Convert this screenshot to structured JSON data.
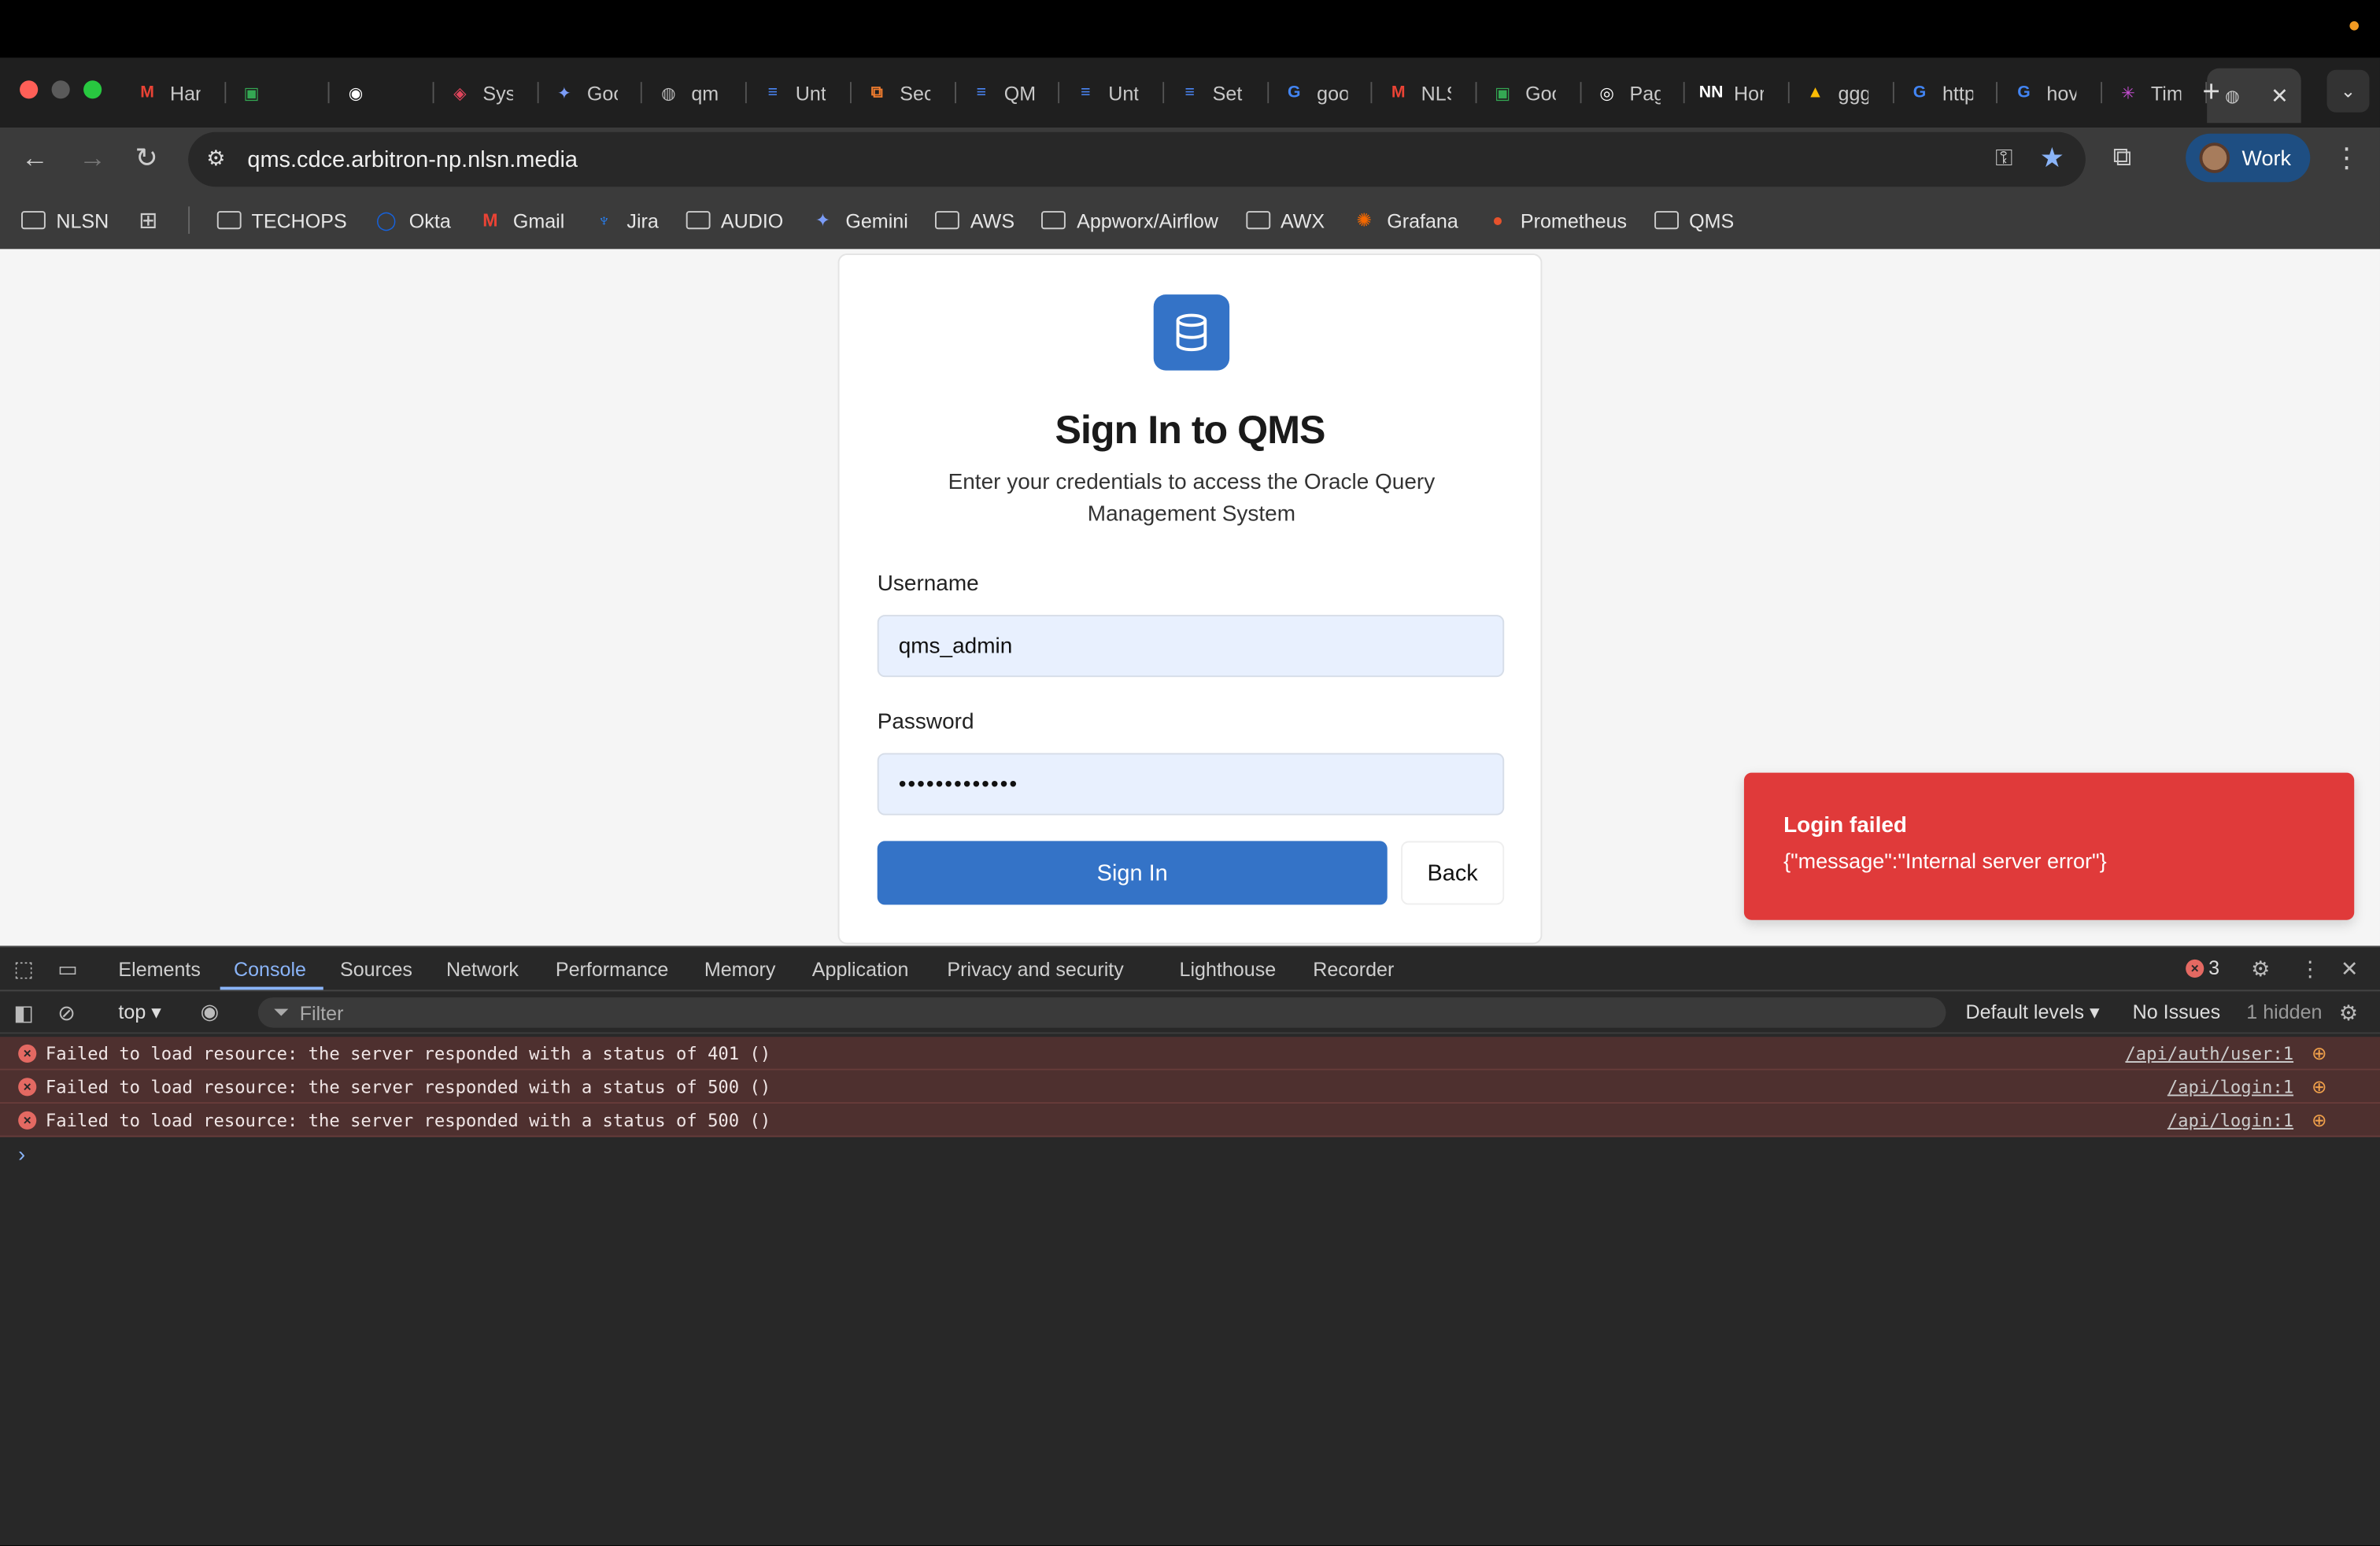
{
  "browser": {
    "tabs": [
      {
        "title": "Har",
        "icon": "gmail-icon",
        "color": "#ea4335",
        "glyph": "M"
      },
      {
        "title": "",
        "icon": "meet-icon",
        "color": "#34a853",
        "glyph": "▣"
      },
      {
        "title": "",
        "icon": "record-icon",
        "color": "#ffffff",
        "glyph": "◉"
      },
      {
        "title": "Sys",
        "icon": "sysdig-icon",
        "color": "#e0455c",
        "glyph": "◈"
      },
      {
        "title": "Goo",
        "icon": "gemini-icon",
        "color": "#7b9cf7",
        "glyph": "✦"
      },
      {
        "title": "qm",
        "icon": "globe-icon",
        "color": "#bbbbbb",
        "glyph": "◍"
      },
      {
        "title": "Unt",
        "icon": "docs-icon",
        "color": "#4a86f5",
        "glyph": "≡"
      },
      {
        "title": "Sec",
        "icon": "sec-icon",
        "color": "#f07c2e",
        "glyph": "⧉"
      },
      {
        "title": "QM",
        "icon": "docs-icon",
        "color": "#4a86f5",
        "glyph": "≡"
      },
      {
        "title": "Unt",
        "icon": "docs-icon",
        "color": "#4a86f5",
        "glyph": "≡"
      },
      {
        "title": "Set",
        "icon": "docs-icon",
        "color": "#4a86f5",
        "glyph": "≡"
      },
      {
        "title": "goo",
        "icon": "google-icon",
        "color": "#4285f4",
        "glyph": "G"
      },
      {
        "title": "NLS",
        "icon": "gmail-icon",
        "color": "#ea4335",
        "glyph": "M"
      },
      {
        "title": "Goo",
        "icon": "meet-icon",
        "color": "#34a853",
        "glyph": "▣"
      },
      {
        "title": "Pag",
        "icon": "github-icon",
        "color": "#ffffff",
        "glyph": "◎"
      },
      {
        "title": "Hor",
        "icon": "nn-icon",
        "color": "#ffffff",
        "glyph": "NN"
      },
      {
        "title": "ggg",
        "icon": "drive-icon",
        "color": "#fbbc04",
        "glyph": "▲"
      },
      {
        "title": "http",
        "icon": "google-icon",
        "color": "#4285f4",
        "glyph": "G"
      },
      {
        "title": "hov",
        "icon": "google-icon",
        "color": "#4285f4",
        "glyph": "G"
      },
      {
        "title": "Tim",
        "icon": "app-icon",
        "color": "#c94fd6",
        "glyph": "✳"
      }
    ],
    "url": "qms.cdce.arbitron-np.nlsn.media",
    "profile": "Work",
    "bookmarks": [
      {
        "label": "NLSN",
        "icon": "folder-link-icon"
      },
      {
        "label": "",
        "icon": "apps-grid-icon"
      },
      {
        "label": "TECHOPS",
        "icon": "folder-icon"
      },
      {
        "label": "Okta",
        "icon": "okta-icon"
      },
      {
        "label": "Gmail",
        "icon": "gmail-icon"
      },
      {
        "label": "Jira",
        "icon": "jira-icon"
      },
      {
        "label": "AUDIO",
        "icon": "folder-icon"
      },
      {
        "label": "Gemini",
        "icon": "gemini-icon"
      },
      {
        "label": "AWS",
        "icon": "folder-icon"
      },
      {
        "label": "Appworx/Airflow",
        "icon": "folder-icon"
      },
      {
        "label": "AWX",
        "icon": "folder-icon"
      },
      {
        "label": "Grafana",
        "icon": "grafana-icon"
      },
      {
        "label": "Prometheus",
        "icon": "prometheus-icon"
      },
      {
        "label": "QMS",
        "icon": "folder-icon"
      }
    ]
  },
  "login": {
    "title": "Sign In to QMS",
    "subtitle": "Enter your credentials to access the Oracle Query Management System",
    "username_label": "Username",
    "username_value": "qms_admin",
    "password_label": "Password",
    "password_value": "•••••••••••••",
    "signin_label": "Sign In",
    "back_label": "Back",
    "accent": "#3473c7"
  },
  "toast": {
    "title": "Login failed",
    "message": "{\"message\":\"Internal server error\"}",
    "color": "#e03a3a"
  },
  "devtools": {
    "tabs": [
      "Elements",
      "Console",
      "Sources",
      "Network",
      "Performance",
      "Memory",
      "Application",
      "Privacy and security",
      "Lighthouse",
      "Recorder"
    ],
    "active_tab": "Console",
    "error_count": "3",
    "context": "top",
    "filter_placeholder": "Filter",
    "levels": "Default levels",
    "issues": "No Issues",
    "hidden": "1 hidden",
    "logs": [
      {
        "message": "Failed to load resource: the server responded with a status of 401 ()",
        "source": "/api/auth/user:1"
      },
      {
        "message": "Failed to load resource: the server responded with a status of 500 ()",
        "source": "/api/login:1"
      },
      {
        "message": "Failed to load resource: the server responded with a status of 500 ()",
        "source": "/api/login:1"
      }
    ]
  }
}
